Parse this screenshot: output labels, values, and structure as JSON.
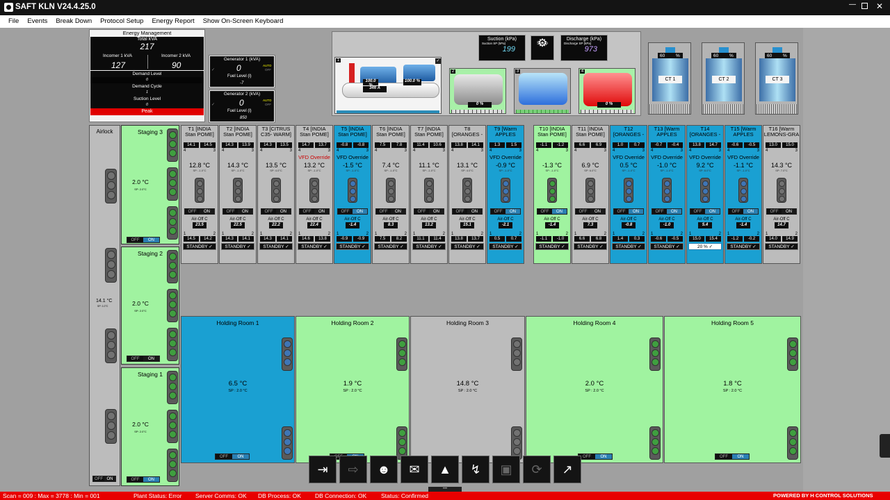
{
  "app": {
    "title": "SAFT KLN V24.4.25.0"
  },
  "menu": [
    "File",
    "Events",
    "Break Down",
    "Protocol Setup",
    "Energy Report",
    "Show On-Screen Keyboard"
  ],
  "energy": {
    "heading": "Energy Management",
    "total_label": "Total kVA",
    "total": "217",
    "incomer1_label": "Incomer 1 kVA",
    "incomer1": "127",
    "incomer2_label": "Incomer 2 kVA",
    "incomer2": "90",
    "demand_level_label": "Demand Level",
    "demand_level": "0",
    "demand_cycle_label": "Demand Cycle",
    "demand_cycle": "1",
    "suction_level_label": "Suction Level",
    "suction_level": "0",
    "peak": "Peak"
  },
  "gen1": {
    "label": "Generator 1 (kVA)",
    "value": "0",
    "auto": "AUTO",
    "off": "OFF",
    "fuel_label": "Fuel Level (l)",
    "fuel": "-7"
  },
  "gen2": {
    "label": "Generator 2 (kVA)",
    "value": "0",
    "auto": "AUTO",
    "off": "OFF",
    "fuel_label": "Fuel Level (l)",
    "fuel": "850"
  },
  "suction": {
    "label": "Suction (kPa)",
    "sp_label": "Suction SP (kPa)",
    "value": "199"
  },
  "discharge": {
    "label": "Discharge (kPa)",
    "sp_label": "Discharge SP (kPa)",
    "value": "973"
  },
  "setup": {
    "label": "Setup"
  },
  "compressors": [
    {
      "num": "1",
      "v1": "100.0",
      "v2": "100.0",
      "unit": "%",
      "amps": "346",
      "amp_unit": "A"
    },
    {
      "num": "2",
      "v1": "0",
      "unit": "%"
    },
    {
      "num": "3",
      "v1": "",
      "unit": ""
    },
    {
      "num": "4",
      "v1": "0",
      "unit": "%"
    }
  ],
  "cooling_towers": [
    {
      "label": "CT 1",
      "pct": "60",
      "unit": "%"
    },
    {
      "label": "CT 2",
      "pct": "60",
      "unit": "%"
    },
    {
      "label": "CT 3",
      "pct": "60",
      "unit": "%"
    }
  ],
  "airlock": {
    "title": "Airlock",
    "temp": "14.1 °C",
    "sp": "SP: 1.0°C",
    "off": "OFF",
    "on": "ON"
  },
  "staging": [
    {
      "title": "Staging 3",
      "temp": "2.0 °C",
      "sp": "SP: 2.0°C",
      "off": "OFF",
      "on": "ON"
    },
    {
      "title": "Staging 2",
      "temp": "2.0 °C",
      "sp": "SP: 2.0°C",
      "off": "OFF",
      "on": "ON"
    },
    {
      "title": "Staging 1",
      "temp": "2.0 °C",
      "sp": "SP: 2.0°C",
      "off": "OFF",
      "on": "ON"
    }
  ],
  "tunnels": [
    {
      "h1": "T1 [INDIA",
      "h2": "Stan POME]",
      "a": "14.1",
      "b": "14.5",
      "vfd": "",
      "temp": "12.8 °C",
      "sp": "SP: -1.0°C",
      "air": "Air-Off C",
      "airv": "23.5",
      "c": "14.5",
      "d": "14.2",
      "status": "STANDBY"
    },
    {
      "h1": "T2 [INDIA",
      "h2": "Stan POME]",
      "a": "14.3",
      "b": "13.9",
      "vfd": "",
      "temp": "14.3 °C",
      "sp": "SP: -1.0°C",
      "air": "Air-Off C",
      "airv": "22.5",
      "c": "14.3",
      "d": "14.1",
      "status": "STANDBY"
    },
    {
      "h1": "T3 [CITRUS",
      "h2": "C35- WARM]",
      "a": "14.3",
      "b": "13.5",
      "vfd": "",
      "temp": "13.5 °C",
      "sp": "SP: 4.0°C",
      "air": "Air-Off C",
      "airv": "22.2",
      "c": "14.3",
      "d": "14.1",
      "status": "STANDBY"
    },
    {
      "h1": "T4 [INDIA",
      "h2": "Stan POME]",
      "a": "14.7",
      "b": "13.7",
      "vfd": "VFD Override",
      "temp": "13.2 °C",
      "sp": "SP: -1.0°C",
      "air": "Air-Off C",
      "airv": "22.4",
      "c": "14.6",
      "d": "13.8",
      "status": "STANDBY"
    },
    {
      "h1": "T5 [INDIA",
      "h2": "Stan POME]",
      "a": "-0.8",
      "b": "-0.8",
      "vfd": "VFD Override",
      "temp": "-1.5 °C",
      "sp": "SP: -1.0°C",
      "air": "Air-Off C",
      "airv": "-1.4",
      "c": "-0.9",
      "d": "-0.9",
      "status": "STANDBY"
    },
    {
      "h1": "T6 [INDIA",
      "h2": "Stan POME]",
      "a": "7.5",
      "b": "7.8",
      "vfd": "",
      "temp": "7.4 °C",
      "sp": "SP: -1.0°C",
      "air": "Air-Off C",
      "airv": "8.3",
      "c": "7.5",
      "d": "8.2",
      "status": "STANDBY"
    },
    {
      "h1": "T7 [INDIA",
      "h2": "Stan POME]",
      "a": "11.4",
      "b": "10.6",
      "vfd": "",
      "temp": "11.1 °C",
      "sp": "SP: -1.0°C",
      "air": "Air-Off C",
      "airv": "13.2",
      "c": "11.1",
      "d": "11.4",
      "status": "STANDBY"
    },
    {
      "h1": "T8",
      "h2": "[ORANGES -",
      "a": "13.8",
      "b": "14.1",
      "vfd": "",
      "temp": "13.1 °C",
      "sp": "SP: 4.0°C",
      "air": "Air-Off C",
      "airv": "15.1",
      "c": "13.8",
      "d": "13.7",
      "status": "STANDBY"
    },
    {
      "h1": "T9 [Warm",
      "h2": "APPLES",
      "a": "1.3",
      "b": "1.5",
      "vfd": "VFD Override",
      "temp": "-0.9 °C",
      "sp": "SP: -1.0°C",
      "air": "Air-Off C",
      "airv": "-2.1",
      "c": "0.5",
      "d": "0.7",
      "status": "STANDBY"
    },
    {
      "h1": "T10 [INDIA",
      "h2": "Stan POME]",
      "a": "-1.1",
      "b": "-1.2",
      "vfd": "",
      "temp": "-1.3 °C",
      "sp": "SP: -1.0°C",
      "air": "Air-Off C",
      "airv": "-1.4",
      "c": "-1.1",
      "d": "-1.0",
      "status": "STANDBY"
    },
    {
      "h1": "T11 [INDIA",
      "h2": "Stan POME]",
      "a": "6.6",
      "b": "6.9",
      "vfd": "",
      "temp": "6.9 °C",
      "sp": "SP: 6.0°C",
      "air": "Air-Off C",
      "airv": "7.3",
      "c": "6.6",
      "d": "6.8",
      "status": "STANDBY"
    },
    {
      "h1": "T12",
      "h2": "[ORANGES -",
      "a": "1.0",
      "b": "0.7",
      "vfd": "VFD Override",
      "temp": "0.5 °C",
      "sp": "SP: -1.0°C",
      "air": "Air-Off C",
      "airv": "-0.8",
      "c": "1.4",
      "d": "0.3",
      "status": "STANDBY"
    },
    {
      "h1": "T13 [Warm",
      "h2": "APPLES",
      "a": "-0.7",
      "b": "-0.4",
      "vfd": "VFD Override",
      "temp": "-1.0 °C",
      "sp": "SP: -1.0°C",
      "air": "Air-Off C",
      "airv": "-1.0",
      "c": "-0.6",
      "d": "-0.5",
      "status": "STANDBY"
    },
    {
      "h1": "T14",
      "h2": "[ORANGES -",
      "a": "13.8",
      "b": "14.7",
      "vfd": "VFD Override",
      "temp": "9.2 °C",
      "sp": "SP: 8.0°C",
      "air": "Air-Off C",
      "airv": "5.4",
      "c": "15.0",
      "d": "15.4",
      "status": "20 %"
    },
    {
      "h1": "T15 [Warm",
      "h2": "APPLES",
      "a": "-0.6",
      "b": "-0.5",
      "vfd": "VFD Override",
      "temp": "-1.1 °C",
      "sp": "SP: -1.0°C",
      "air": "Air-Off C",
      "airv": "-1.4",
      "c": "-1.2",
      "d": "-0.2",
      "status": "STANDBY"
    },
    {
      "h1": "T16 [Warm",
      "h2": "LEMONS-GRA",
      "a": "13.0",
      "b": "15.0",
      "vfd": "",
      "temp": "14.3 °C",
      "sp": "SP: 7.0°C",
      "air": "Air-Off C",
      "airv": "14.7",
      "c": "14.0",
      "d": "14.9",
      "status": "STANDBY"
    }
  ],
  "rooms": [
    {
      "title": "Holding Room 1",
      "temp": "6.5 °C",
      "sp": "SP : 2.0 °C",
      "off": "OFF",
      "on": "ON"
    },
    {
      "title": "Holding Room 2",
      "temp": "1.9 °C",
      "sp": "SP : 2.0 °C",
      "off": "OFF",
      "on": "ON"
    },
    {
      "title": "Holding Room 3",
      "temp": "14.8 °C",
      "sp": "SP : 2.0 °C",
      "off": "OFF",
      "on": "ON"
    },
    {
      "title": "Holding Room 4",
      "temp": "2.0 °C",
      "sp": "SP : 2.0 °C",
      "off": "OFF",
      "on": "ON"
    },
    {
      "title": "Holding Room 5",
      "temp": "1.8 °C",
      "sp": "SP : 2.0 °C",
      "off": "OFF",
      "on": "ON"
    }
  ],
  "toolbar": [
    "login-icon",
    "logout-icon",
    "user-settings-icon",
    "mail-icon",
    "alarm-icon",
    "energy-icon",
    "save-icon",
    "refresh-icon",
    "fullscreen-icon"
  ],
  "status": {
    "scan": "Scan = 009 : Max = 3778 : Min = 001",
    "plant": "Plant Status: Error",
    "server": "Server Comms: OK",
    "db_process": "DB Process:  OK",
    "db_conn": "DB Connection:  OK",
    "status": "Status:  Confirmed",
    "powered": "POWERED BY H CONTROL SOLUTIONS"
  },
  "colors": {
    "green": "#a0f3a0",
    "blue": "#1aa0d2",
    "grey": "#bcbcbc",
    "red": "#e80000"
  }
}
